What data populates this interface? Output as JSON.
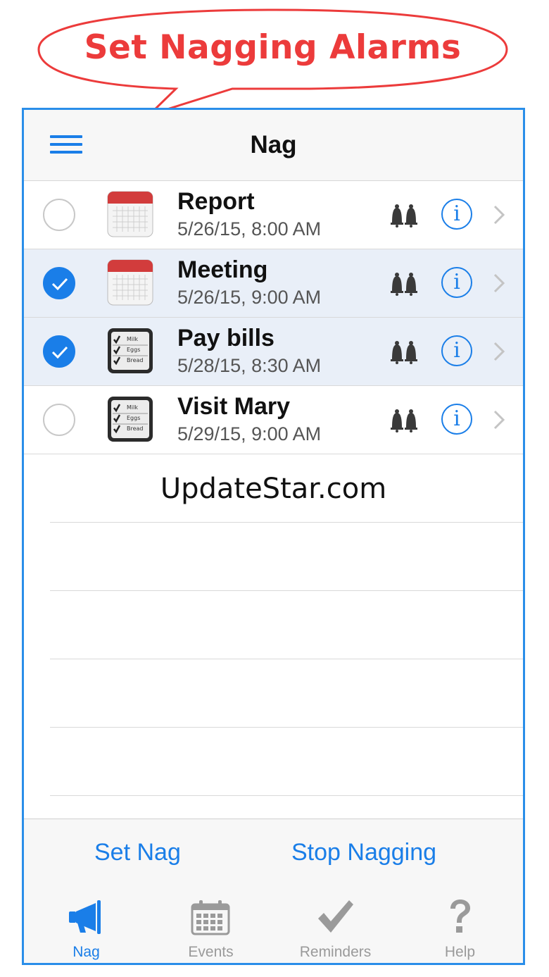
{
  "banner": {
    "text": "Set Nagging Alarms",
    "color": "#ec3b3b"
  },
  "navbar": {
    "title": "Nag",
    "menu_icon": "hamburger-menu-icon"
  },
  "items": [
    {
      "title": "Report",
      "date": "5/26/15, 8:00 AM",
      "checked": false,
      "icon": "calendar-icon"
    },
    {
      "title": "Meeting",
      "date": "5/26/15, 9:00 AM",
      "checked": true,
      "icon": "calendar-icon"
    },
    {
      "title": "Pay bills",
      "date": "5/28/15, 8:30 AM",
      "checked": true,
      "icon": "checklist-icon"
    },
    {
      "title": "Visit Mary",
      "date": "5/29/15, 9:00 AM",
      "checked": false,
      "icon": "checklist-icon"
    }
  ],
  "checklist_labels": [
    "Milk",
    "Eggs",
    "Bread"
  ],
  "info_glyph": "i",
  "watermark": "UpdateStar.com",
  "actions": {
    "set_nag": "Set Nag",
    "stop_nagging": "Stop Nagging"
  },
  "tabs": [
    {
      "label": "Nag",
      "icon": "megaphone-icon",
      "active": true
    },
    {
      "label": "Events",
      "icon": "calendar-grid-icon",
      "active": false
    },
    {
      "label": "Reminders",
      "icon": "checkmark-icon",
      "active": false
    },
    {
      "label": "Help",
      "icon": "question-mark-icon",
      "active": false
    }
  ],
  "colors": {
    "accent": "#1a7ee8",
    "selected_row": "#e9eff8",
    "frame": "#2a8ee9"
  }
}
